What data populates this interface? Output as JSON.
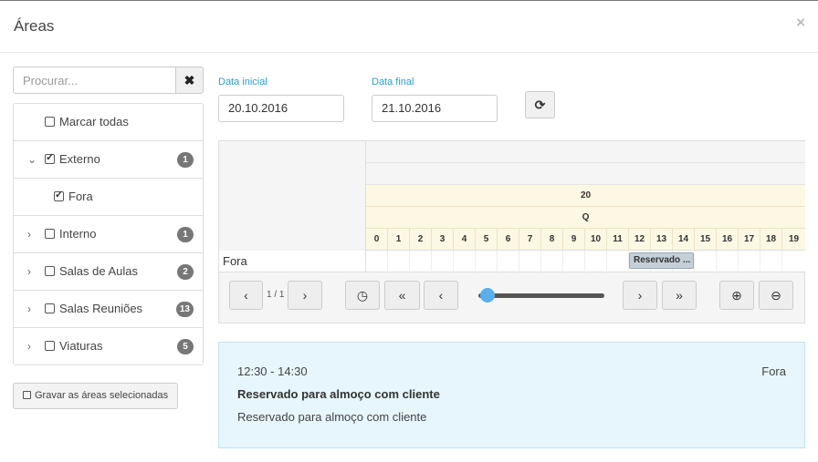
{
  "dialog": {
    "title": "Áreas",
    "close_glyph": "×"
  },
  "search": {
    "placeholder": "Procurar...",
    "clear_glyph": "✖"
  },
  "tree": {
    "items": [
      {
        "label": "Marcar todas",
        "checked": false,
        "badge": ""
      },
      {
        "label": "Externo",
        "checked": true,
        "expanded": true,
        "badge": "1"
      },
      {
        "label": "Fora",
        "checked": true,
        "badge": ""
      },
      {
        "label": "Interno",
        "checked": false,
        "badge": "1"
      },
      {
        "label": "Salas de Aulas",
        "checked": false,
        "badge": "2"
      },
      {
        "label": "Salas Reuniões",
        "checked": false,
        "badge": "13"
      },
      {
        "label": "Viaturas",
        "checked": false,
        "badge": "5"
      }
    ]
  },
  "save_button": {
    "label": "Gravar as áreas selecionadas"
  },
  "dates": {
    "start_label": "Data inicial",
    "start_value": "20.10.2016",
    "end_label": "Data final",
    "end_value": "21.10.2016"
  },
  "scheduler": {
    "day_number": "20",
    "weekday": "Q",
    "hours": [
      "0",
      "1",
      "2",
      "3",
      "4",
      "5",
      "6",
      "7",
      "8",
      "9",
      "10",
      "11",
      "12",
      "13",
      "14",
      "15",
      "16",
      "17",
      "18",
      "19"
    ],
    "resource_name": "Fora",
    "event_label": "Reservado ...",
    "page_info": "1 / 1"
  },
  "toolbar": {
    "prev": "‹",
    "next": "›",
    "clock": "🕘",
    "first": "«",
    "back": "‹",
    "forward": "›",
    "last": "»",
    "zoom_in": "⊕",
    "zoom_out": "⊖",
    "slider_value": 0.1
  },
  "detail": {
    "time": "12:30 - 14:30",
    "location": "Fora",
    "title": "Reservado para almoço com cliente",
    "description": "Reservado para almoço com cliente"
  }
}
